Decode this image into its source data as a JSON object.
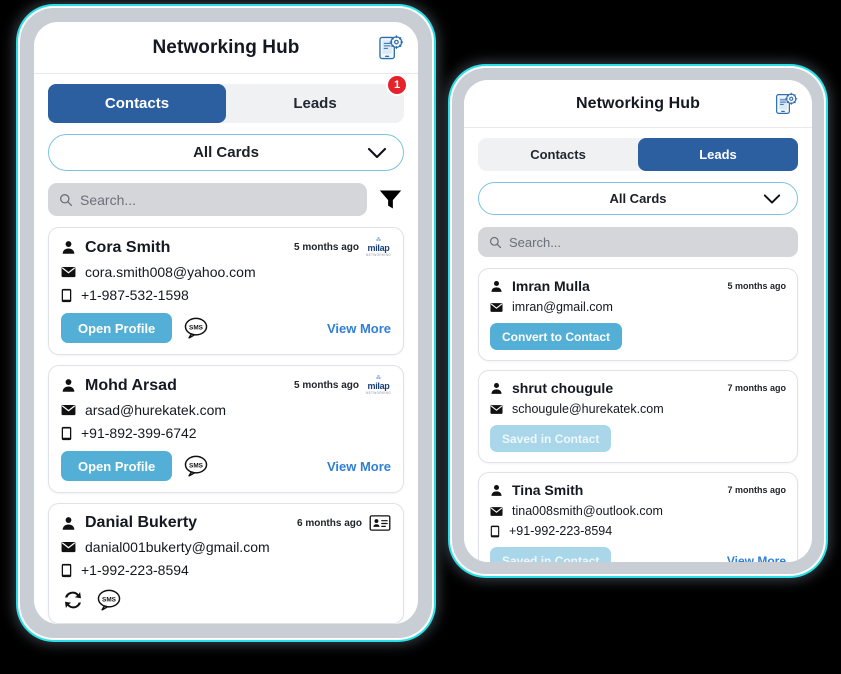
{
  "app": {
    "title": "Networking Hub",
    "header_icon": "device-settings-icon"
  },
  "phone_left": {
    "tabs": [
      {
        "label": "Contacts",
        "active": true,
        "badge": null
      },
      {
        "label": "Leads",
        "active": false,
        "badge": "1"
      }
    ],
    "filter_select": {
      "value": "All Cards",
      "chevron": "chevron-down-icon"
    },
    "search": {
      "value": "",
      "placeholder": "Search..."
    },
    "filter_icon": "funnel-filter-icon",
    "cards": [
      {
        "name": "Cora Smith",
        "time": "5 months ago",
        "source_icon": "milap-logo",
        "email": "cora.smith008@yahoo.com",
        "phone": "+1-987-532-1598",
        "primary_action": "Open Profile",
        "sms_icon": "sms-bubble-icon",
        "view_more": "View More"
      },
      {
        "name": "Mohd Arsad",
        "time": "5 months ago",
        "source_icon": "milap-logo",
        "email": "arsad@hurekatek.com",
        "phone": "+91-892-399-6742",
        "primary_action": "Open Profile",
        "sms_icon": "sms-bubble-icon",
        "view_more": "View More"
      },
      {
        "name": "Danial Bukerty",
        "time": "6 months ago",
        "source_icon": "contact-card-icon",
        "email": "danial001bukerty@gmail.com",
        "phone": "+1-992-223-8594",
        "primary_action": null,
        "sync_icon": "sync-refresh-icon",
        "sms_icon": "sms-bubble-icon",
        "view_more": null
      }
    ]
  },
  "phone_right": {
    "tabs": [
      {
        "label": "Contacts",
        "active": false,
        "badge": null
      },
      {
        "label": "Leads",
        "active": true,
        "badge": null
      }
    ],
    "filter_select": {
      "value": "All Cards",
      "chevron": "chevron-down-icon"
    },
    "search": {
      "value": "",
      "placeholder": "Search..."
    },
    "cards": [
      {
        "name": "Imran Mulla",
        "time": "5 months ago",
        "email": "imran@gmail.com",
        "phone": null,
        "primary_action": "Convert to Contact",
        "primary_disabled": false,
        "view_more": null
      },
      {
        "name": "shrut chougule",
        "time": "7 months ago",
        "email": "schougule@hurekatek.com",
        "phone": null,
        "primary_action": "Saved in Contact",
        "primary_disabled": true,
        "view_more": null
      },
      {
        "name": "Tina Smith",
        "time": "7 months ago",
        "email": "tina008smith@outlook.com",
        "phone": "+91-992-223-8594",
        "primary_action": "Saved in Contact",
        "primary_disabled": true,
        "view_more": "View More"
      }
    ]
  },
  "colors": {
    "tab_active": "#2B5FA0",
    "button_primary": "#53AFD6",
    "button_disabled": "#a9d6e8",
    "link": "#2f7fd4",
    "badge": "#e6222a",
    "frame_glow": "#28e0e8"
  }
}
